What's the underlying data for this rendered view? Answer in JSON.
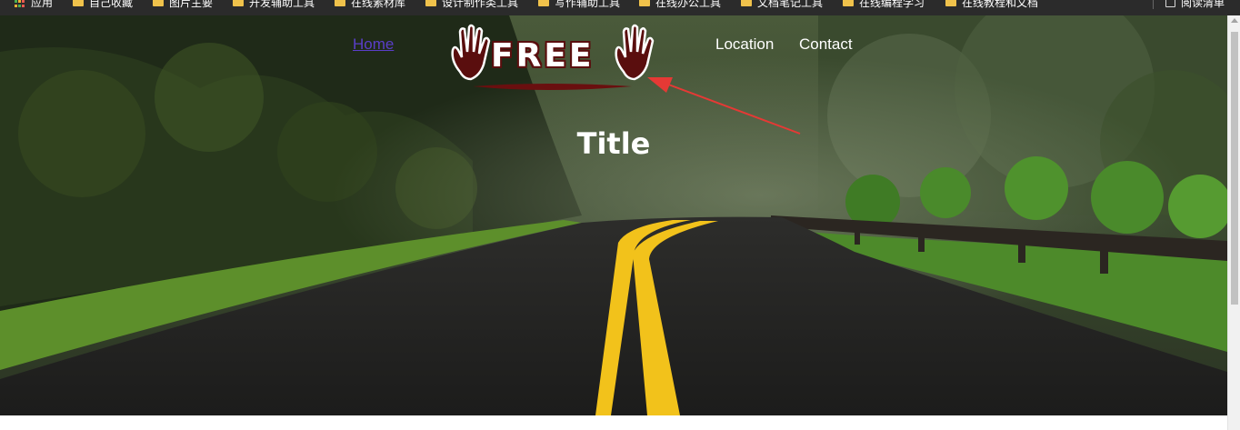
{
  "bookmarks_bar": {
    "apps_label": "应用",
    "items": [
      {
        "label": "自己收藏",
        "icon": "folder-icon"
      },
      {
        "label": "图片主要",
        "icon": "folder-icon"
      },
      {
        "label": "开发辅助工具",
        "icon": "folder-icon"
      },
      {
        "label": "在线素材库",
        "icon": "folder-icon"
      },
      {
        "label": "设计制作类工具",
        "icon": "folder-icon"
      },
      {
        "label": "写作辅助工具",
        "icon": "folder-icon"
      },
      {
        "label": "在线办公工具",
        "icon": "folder-icon"
      },
      {
        "label": "文档笔记工具",
        "icon": "folder-icon"
      },
      {
        "label": "在线编程学习",
        "icon": "folder-icon"
      },
      {
        "label": "在线教程和文档",
        "icon": "folder-icon"
      }
    ],
    "reading_list_label": "阅读清单"
  },
  "nav": {
    "home": "Home",
    "location": "Location",
    "contact": "Contact"
  },
  "logo": {
    "text": "FREE",
    "icon": "hand-icon",
    "color": "#5a0e0e"
  },
  "hero": {
    "title": "Title"
  },
  "colors": {
    "arrow": "#e53935",
    "home_link": "#5a3ec8",
    "road_line": "#f2c21b"
  }
}
